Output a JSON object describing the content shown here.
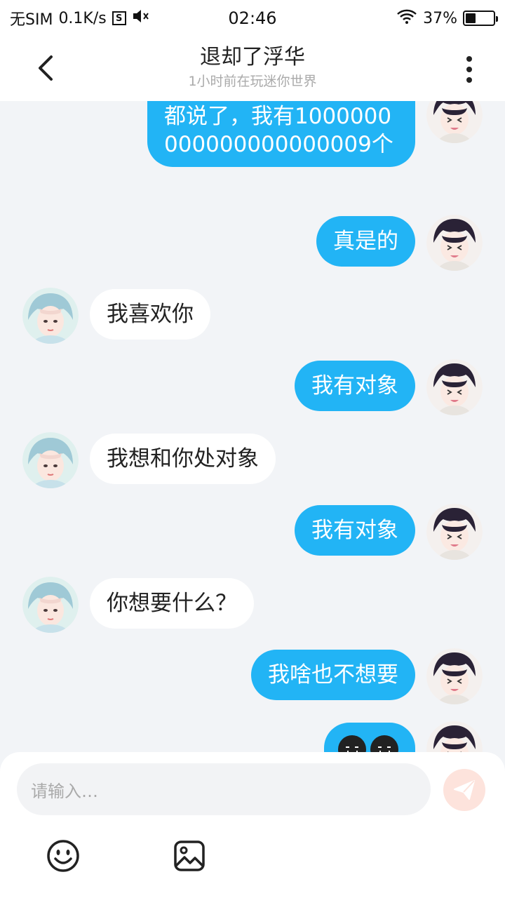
{
  "status_bar": {
    "carrier": "无SIM",
    "speed": "0.1K/s",
    "sim_icon_letter": "S",
    "time": "02:46",
    "battery_text": "37%",
    "battery_level": 0.37,
    "icons": [
      "sim-icon",
      "mute-icon",
      "wifi-icon",
      "battery-icon"
    ]
  },
  "header": {
    "title": "退却了浮华",
    "subtitle": "1小时前在玩迷你世界",
    "back_icon": "chevron-left-icon",
    "more_icon": "more-vertical-icon"
  },
  "messages": [
    {
      "from": "me",
      "text": "都说了，我有1000000000000000000009个"
    },
    {
      "from": "me",
      "text": "真是的"
    },
    {
      "from": "them",
      "text": "我喜欢你"
    },
    {
      "from": "me",
      "text": "我有对象"
    },
    {
      "from": "them",
      "text": "我想和你处对象"
    },
    {
      "from": "me",
      "text": "我有对象"
    },
    {
      "from": "them",
      "text": "你想要什么？"
    },
    {
      "from": "me",
      "text": "我啥也不想要"
    },
    {
      "from": "me",
      "text": "",
      "emoji": [
        "sad-face-emoji",
        "sad-face-emoji"
      ]
    }
  ],
  "input": {
    "placeholder": "请输入…",
    "send_icon": "send-icon",
    "tools": [
      "emoji-icon",
      "image-icon"
    ]
  },
  "colors": {
    "my_bubble": "#22b4f5",
    "their_bubble": "#ffffff",
    "background": "#f2f4f7",
    "send_button": "#fde3dc"
  }
}
